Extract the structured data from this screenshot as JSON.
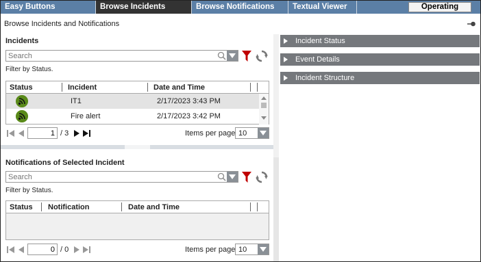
{
  "tabs": [
    {
      "label": "Easy Buttons",
      "active": false
    },
    {
      "label": "Browse Incidents",
      "active": true
    },
    {
      "label": "Browse Notifications",
      "active": false
    },
    {
      "label": "Textual Viewer",
      "active": false
    }
  ],
  "mode_status": "Operating",
  "page_title": "Browse Incidents and Notifications",
  "incidents": {
    "title": "Incidents",
    "search_placeholder": "Search",
    "filter_note": "Filter by Status.",
    "columns": [
      "Status",
      "Incident",
      "Date and Time"
    ],
    "rows": [
      {
        "incident": "IT1",
        "datetime": "2/17/2023 3:43 PM",
        "selected": true
      },
      {
        "incident": "Fire alert",
        "datetime": "2/17/2023 3:42 PM",
        "selected": false
      }
    ],
    "pager": {
      "page": "1",
      "total": "/ 3",
      "items_per_page_label": "Items per page:",
      "items_per_page": "10"
    }
  },
  "notifications": {
    "title": "Notifications of Selected Incident",
    "search_placeholder": "Search",
    "filter_note": "Filter by Status.",
    "columns": [
      "Status",
      "Notification",
      "Date and Time"
    ],
    "pager": {
      "page": "0",
      "total": "/ 0",
      "items_per_page_label": "Items per page:",
      "items_per_page": "10"
    }
  },
  "details_panels": [
    "Incident Status",
    "Event Details",
    "Incident Structure"
  ],
  "colors": {
    "tab_bar": "#5b7fa6",
    "tab_active": "#333333",
    "status_icon": "#5a8a1a",
    "filter_icon": "#c00000",
    "panel_header": "#75787c"
  }
}
